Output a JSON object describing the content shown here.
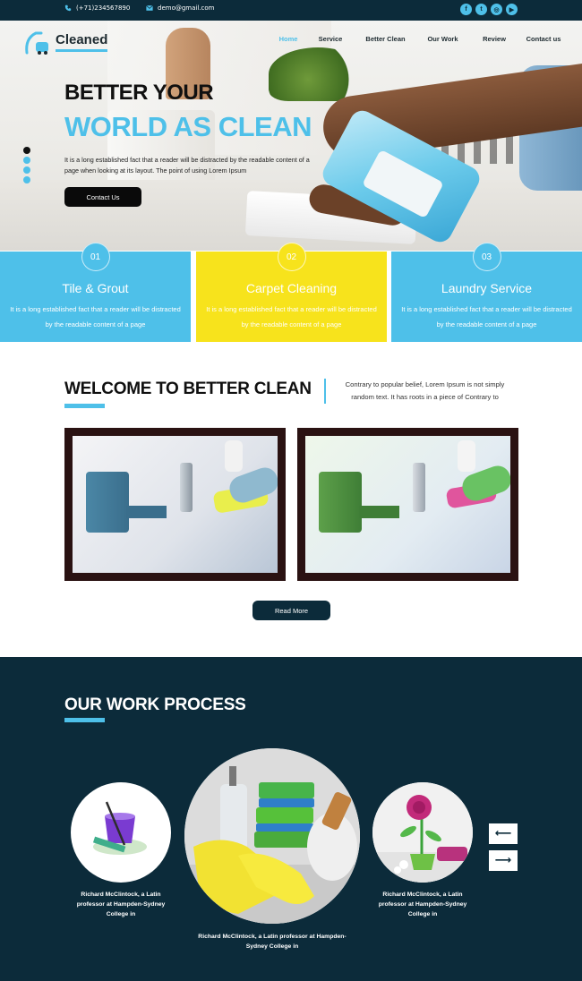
{
  "topbar": {
    "phone": "(+71)234567890",
    "email": "demo@gmail.com",
    "social": [
      "f",
      "t",
      "ig",
      "yt"
    ]
  },
  "header": {
    "logo_text": "Cleaned",
    "nav": [
      {
        "label": "Home",
        "active": true
      },
      {
        "label": "Service",
        "active": false
      },
      {
        "label": "Better Clean",
        "active": false
      },
      {
        "label": "Our Work",
        "active": false
      },
      {
        "label": "Review",
        "active": false
      },
      {
        "label": "Contact us",
        "active": false
      }
    ]
  },
  "hero": {
    "title_line1": "BETTER YOUR",
    "title_line2": "WORLD AS CLEAN",
    "text": "It is a long established fact that a reader will be distracted by the readable content of a page when looking at its layout. The point of using Lorem Ipsum",
    "button": "Contact Us",
    "slides": 4,
    "active_slide": 1
  },
  "services": [
    {
      "num": "01",
      "title": "Tile & Grout",
      "text": "It is a long established fact that a reader will be distracted by the readable content of a page",
      "color": "#4ec0e9"
    },
    {
      "num": "02",
      "title": "Carpet Cleaning",
      "text": "It is a long established fact that a reader will be distracted by the readable content of a page",
      "color": "#f7e31c"
    },
    {
      "num": "03",
      "title": "Laundry Service",
      "text": "It is a long established fact that a reader will be distracted by the readable content of a page",
      "color": "#4ec0e9"
    }
  ],
  "welcome": {
    "title": "WELCOME TO BETTER CLEAN",
    "text": "Contrary to popular belief, Lorem Ipsum is not simply random text. It has roots in a piece of Contrary to",
    "read_more": "Read More"
  },
  "process": {
    "title": "OUR WORK PROCESS",
    "items": [
      {
        "caption": "Richard McClintock, a Latin professor at Hampden-Sydney College in",
        "icon": "mop-bucket-icon"
      },
      {
        "caption": "Richard McClintock, a Latin professor at Hampden-Sydney College in",
        "icon": "cleaning-supplies-image"
      },
      {
        "caption": "Richard McClintock, a Latin professor at Hampden-Sydney College in",
        "icon": "flower-pot-image"
      }
    ],
    "prev": "⟵",
    "next": "⟶"
  },
  "colors": {
    "accent": "#4ec0e9",
    "yellow": "#f7e31c",
    "dark": "#0c2b3a"
  }
}
